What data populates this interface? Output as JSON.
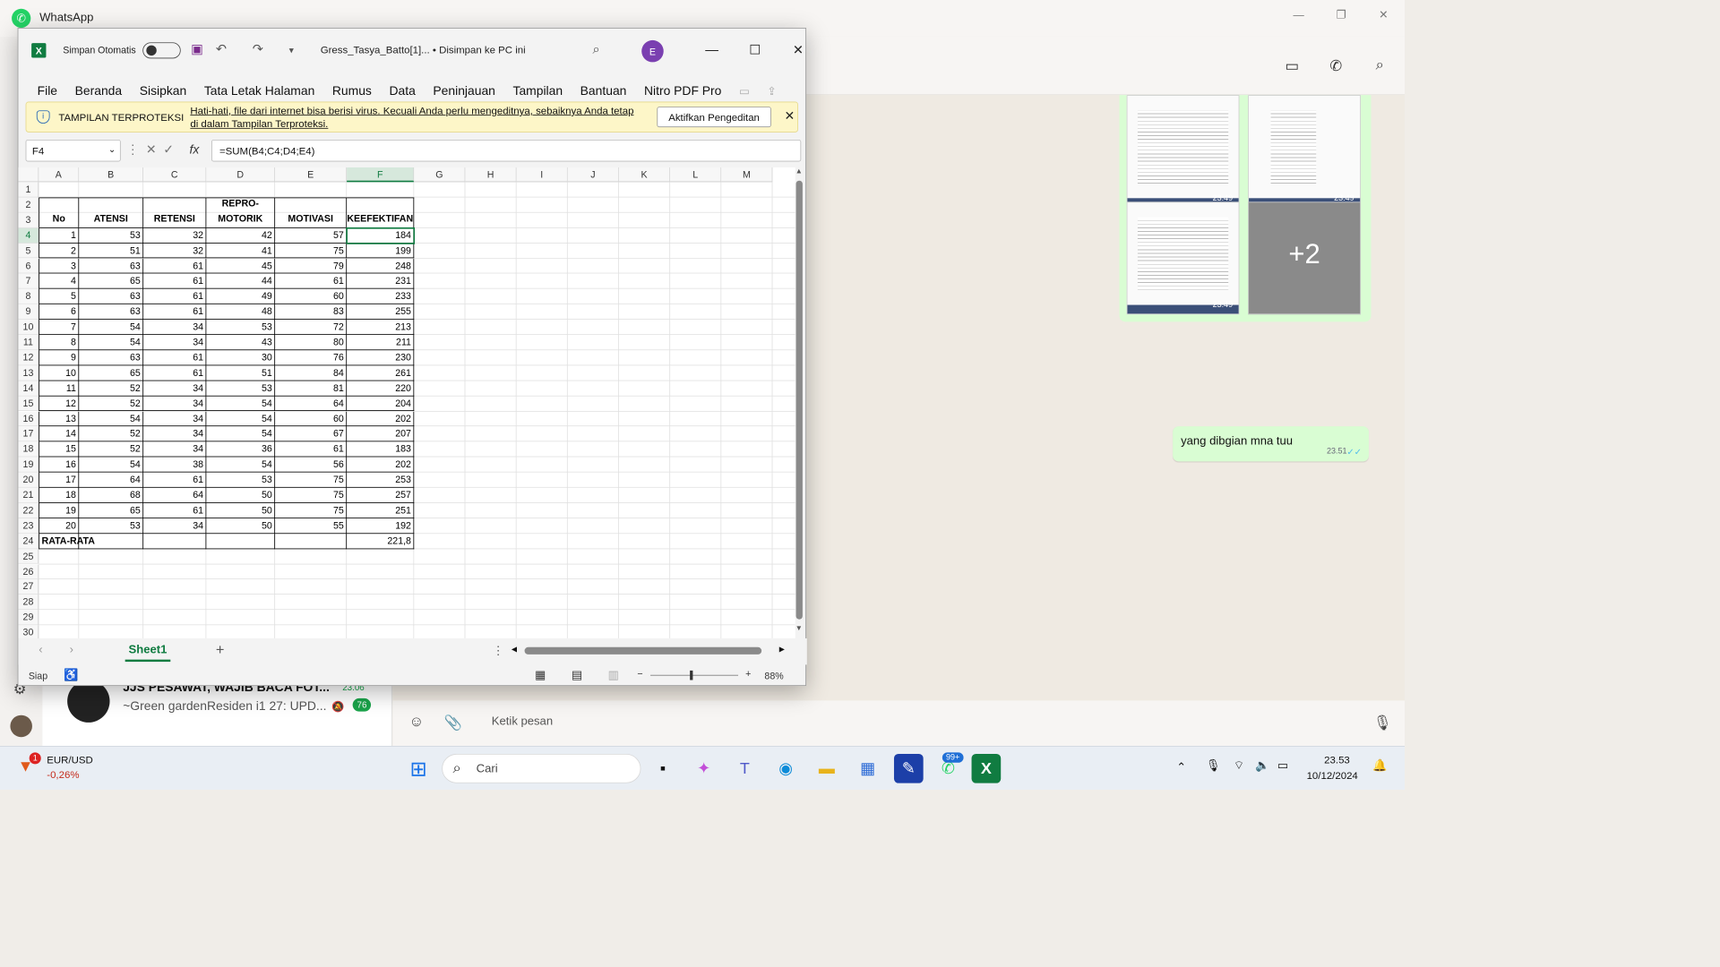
{
  "whatsapp": {
    "app_title": "WhatsApp",
    "message_text": "yang dibgian mna tuu",
    "message_time": "23.51",
    "thumb_times": [
      "23.49",
      "23.49",
      "23.49"
    ],
    "more_images": "+2",
    "compose_placeholder": "Ketik pesan",
    "chat_item": {
      "title": "JJS PESAWAT, WAJIB BACA FOT...",
      "preview": "~Green gardenResiden i1 27: UPD...",
      "time": "23.06",
      "unread": "76"
    }
  },
  "excel": {
    "autosave_label": "Simpan Otomatis",
    "document_name": "Gress_Tasya_Batto[1]...  •  Disimpan ke PC ini",
    "avatar_letter": "E",
    "menu": [
      "File",
      "Beranda",
      "Sisipkan",
      "Tata Letak Halaman",
      "Rumus",
      "Data",
      "Peninjauan",
      "Tampilan",
      "Bantuan",
      "Nitro PDF Pro"
    ],
    "protected_view": {
      "label": "TAMPILAN TERPROTEKSI",
      "message": "Hati-hati, file dari internet bisa berisi virus. Kecuali Anda perlu mengeditnya, sebaiknya Anda tetap di dalam Tampilan Terproteksi.",
      "button": "Aktifkan Pengeditan"
    },
    "name_box": "F4",
    "formula": "=SUM(B4;C4;D4;E4)",
    "columns": [
      "A",
      "B",
      "C",
      "D",
      "E",
      "F",
      "G",
      "H",
      "I",
      "J",
      "K",
      "L",
      "M"
    ],
    "rows": [
      "1",
      "2",
      "3",
      "4",
      "5",
      "6",
      "7",
      "8",
      "9",
      "10",
      "11",
      "12",
      "13",
      "14",
      "15",
      "16",
      "17",
      "18",
      "19",
      "20",
      "21",
      "22",
      "23",
      "24",
      "25",
      "26",
      "27",
      "28",
      "29",
      "30"
    ],
    "table_headers": [
      "No",
      "ATENSI",
      "RETENSI",
      "REPRO-\nMOTORIK",
      "MOTIVASI",
      "KEEFEKTIFAN"
    ],
    "table_rows": [
      [
        "1",
        "53",
        "32",
        "42",
        "57",
        "184"
      ],
      [
        "2",
        "51",
        "32",
        "41",
        "75",
        "199"
      ],
      [
        "3",
        "63",
        "61",
        "45",
        "79",
        "248"
      ],
      [
        "4",
        "65",
        "61",
        "44",
        "61",
        "231"
      ],
      [
        "5",
        "63",
        "61",
        "49",
        "60",
        "233"
      ],
      [
        "6",
        "63",
        "61",
        "48",
        "83",
        "255"
      ],
      [
        "7",
        "54",
        "34",
        "53",
        "72",
        "213"
      ],
      [
        "8",
        "54",
        "34",
        "43",
        "80",
        "211"
      ],
      [
        "9",
        "63",
        "61",
        "30",
        "76",
        "230"
      ],
      [
        "10",
        "65",
        "61",
        "51",
        "84",
        "261"
      ],
      [
        "11",
        "52",
        "34",
        "53",
        "81",
        "220"
      ],
      [
        "12",
        "52",
        "34",
        "54",
        "64",
        "204"
      ],
      [
        "13",
        "54",
        "34",
        "54",
        "60",
        "202"
      ],
      [
        "14",
        "52",
        "34",
        "54",
        "67",
        "207"
      ],
      [
        "15",
        "52",
        "34",
        "36",
        "61",
        "183"
      ],
      [
        "16",
        "54",
        "38",
        "54",
        "56",
        "202"
      ],
      [
        "17",
        "64",
        "61",
        "53",
        "75",
        "253"
      ],
      [
        "18",
        "68",
        "64",
        "50",
        "75",
        "257"
      ],
      [
        "19",
        "65",
        "61",
        "50",
        "75",
        "251"
      ],
      [
        "20",
        "53",
        "34",
        "50",
        "55",
        "192"
      ]
    ],
    "average_label": "RATA-RATA",
    "average_value": "221,8",
    "sheet_name": "Sheet1",
    "status": "Siap",
    "zoom": "88%"
  },
  "taskbar": {
    "ticker_symbol": "EUR/USD",
    "ticker_change": "-0,26%",
    "ticker_badge": "1",
    "search_placeholder": "Cari",
    "whatsapp_badge": "99+",
    "time": "23.53",
    "date": "10/12/2024"
  },
  "colors": {
    "excel_green": "#107c41",
    "wa_bubble": "#d9fdd3",
    "warning_bar": "#fdf6c8"
  }
}
